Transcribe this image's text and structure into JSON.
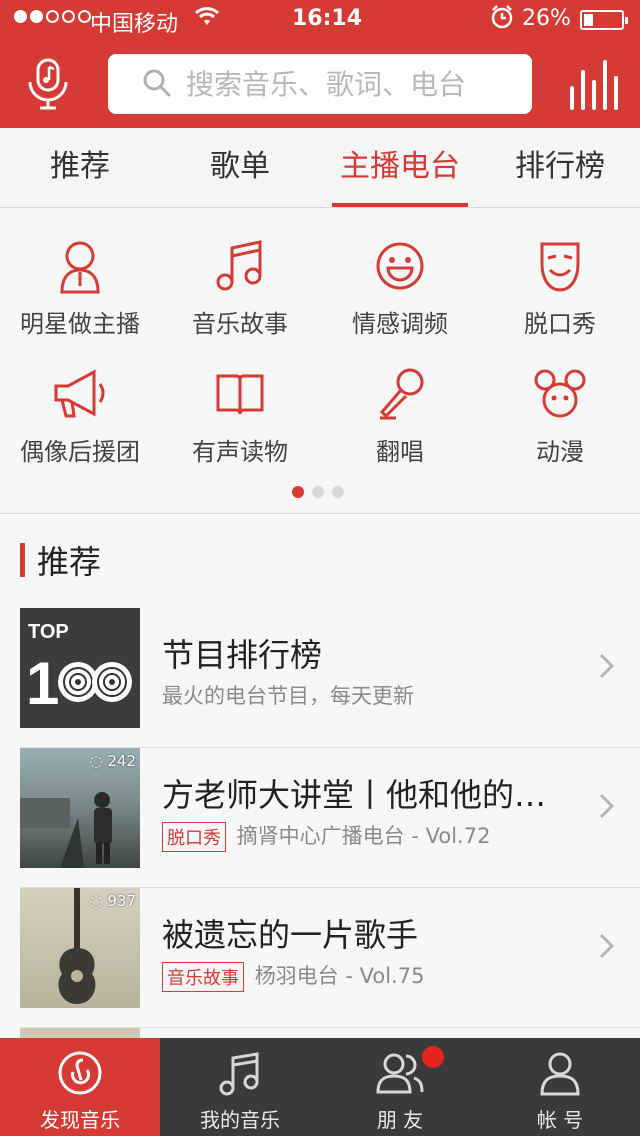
{
  "status_bar": {
    "carrier": "中国移动",
    "time": "16:14",
    "battery_percent": "26%",
    "battery_level": 0.26,
    "signal_bars_filled": 2,
    "signal_bars_total": 5
  },
  "header": {
    "search_placeholder": "搜索音乐、歌词、电台",
    "mic_icon": "microphone-music-icon",
    "now_playing_icon": "equalizer-icon"
  },
  "tabs": [
    {
      "label": "推荐",
      "active": false
    },
    {
      "label": "歌单",
      "active": false
    },
    {
      "label": "主播电台",
      "active": true
    },
    {
      "label": "排行榜",
      "active": false
    }
  ],
  "categories": [
    {
      "label": "明星做主播",
      "icon": "star-host-icon"
    },
    {
      "label": "音乐故事",
      "icon": "music-note-icon"
    },
    {
      "label": "情感调频",
      "icon": "smiley-icon"
    },
    {
      "label": "脱口秀",
      "icon": "mask-icon"
    },
    {
      "label": "偶像后援团",
      "icon": "megaphone-icon"
    },
    {
      "label": "有声读物",
      "icon": "book-icon"
    },
    {
      "label": "翻唱",
      "icon": "microphone-icon"
    },
    {
      "label": "动漫",
      "icon": "mouse-ears-icon"
    }
  ],
  "pager": {
    "pages": 3,
    "current": 1
  },
  "section": {
    "title": "推荐"
  },
  "list": [
    {
      "title": "节目排行榜",
      "subtitle": "最火的电台节目，每天更新",
      "tag": "",
      "thumb_text_top": "TOP",
      "thumb_text_num": "1"
    },
    {
      "title": "方老师大讲堂丨他和他的…",
      "tag": "脱口秀",
      "subtitle": "摘肾中心广播电台 - Vol.72",
      "play_count": "242"
    },
    {
      "title": "被遗忘的一片歌手",
      "tag": "音乐故事",
      "subtitle": "杨羽电台 - Vol.75",
      "play_count": "937"
    }
  ],
  "bottom_nav": [
    {
      "label": "发现音乐",
      "active": true,
      "icon": "netease-logo-icon"
    },
    {
      "label": "我的音乐",
      "active": false,
      "icon": "music-note-icon"
    },
    {
      "label": "朋 友",
      "active": false,
      "icon": "friends-icon",
      "has_badge": true
    },
    {
      "label": "帐 号",
      "active": false,
      "icon": "account-icon"
    }
  ],
  "colors": {
    "brand_red": "#d63a35",
    "nav_dark": "#3a3a3c"
  }
}
